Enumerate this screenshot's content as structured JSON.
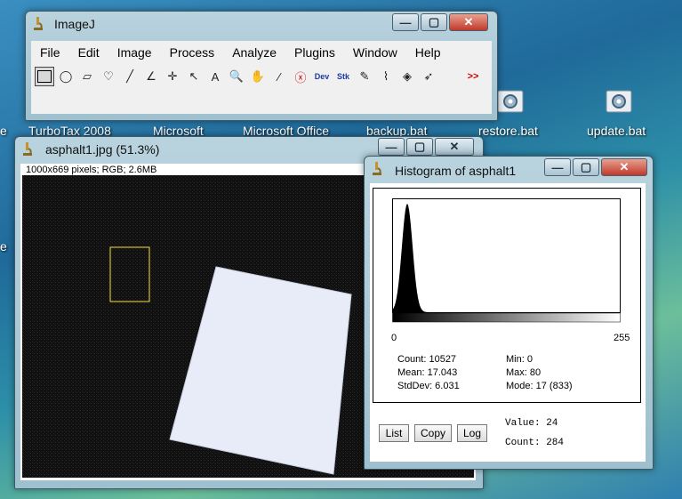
{
  "desktop": {
    "icons": [
      {
        "label": "TurboTax 2008"
      },
      {
        "label": "Microsoft"
      },
      {
        "label": "Microsoft Office"
      },
      {
        "label": "backup.bat"
      },
      {
        "label": "restore.bat"
      },
      {
        "label": "update.bat"
      },
      {
        "label": "e"
      },
      {
        "label": "e"
      }
    ]
  },
  "imagej": {
    "title": "ImageJ",
    "menu": [
      "File",
      "Edit",
      "Image",
      "Process",
      "Analyze",
      "Plugins",
      "Window",
      "Help"
    ],
    "tools": [
      {
        "name": "rectangle-tool-icon",
        "glyph": ""
      },
      {
        "name": "oval-tool-icon",
        "glyph": "◯"
      },
      {
        "name": "polygon-tool-icon",
        "glyph": "▱"
      },
      {
        "name": "freehand-tool-icon",
        "glyph": "♡"
      },
      {
        "name": "line-tool-icon",
        "glyph": "╱"
      },
      {
        "name": "angle-tool-icon",
        "glyph": "∠"
      },
      {
        "name": "point-tool-icon",
        "glyph": "✛"
      },
      {
        "name": "wand-tool-icon",
        "glyph": "↖"
      },
      {
        "name": "text-tool-icon",
        "glyph": "A"
      },
      {
        "name": "magnifier-tool-icon",
        "glyph": "🔍"
      },
      {
        "name": "hand-tool-icon",
        "glyph": "✋"
      },
      {
        "name": "dropper-tool-icon",
        "glyph": "⁄"
      },
      {
        "name": "stop-tool-icon",
        "glyph": "ⓧ"
      },
      {
        "name": "dev-tool-icon",
        "glyph": "Dev"
      },
      {
        "name": "stk-tool-icon",
        "glyph": "Stk"
      },
      {
        "name": "pencil-tool-icon",
        "glyph": "✎"
      },
      {
        "name": "brush-tool-icon",
        "glyph": "⌇"
      },
      {
        "name": "flood-fill-tool-icon",
        "glyph": "◈"
      },
      {
        "name": "arrow-tool-icon",
        "glyph": "➶"
      },
      {
        "name": "blank-tool-icon",
        "glyph": ""
      },
      {
        "name": "more-tools-icon",
        "glyph": ">>"
      }
    ]
  },
  "image_window": {
    "title": "asphalt1.jpg (51.3%)",
    "info": "1000x669 pixels; RGB; 2.6MB"
  },
  "histogram": {
    "title": "Histogram of asphalt1",
    "axis_min": "0",
    "axis_max": "255",
    "count": "Count: 10527",
    "mean": "Mean: 17.043",
    "stddev": "StdDev: 6.031",
    "min": "Min: 0",
    "max": "Max: 80",
    "mode": "Mode: 17 (833)",
    "value": "Value: 24",
    "count_at_value": "Count: 284",
    "buttons": {
      "list": "List",
      "copy": "Copy",
      "log": "Log"
    }
  },
  "window_buttons": {
    "minimize": "—",
    "maximize": "▢",
    "close": "✕"
  }
}
